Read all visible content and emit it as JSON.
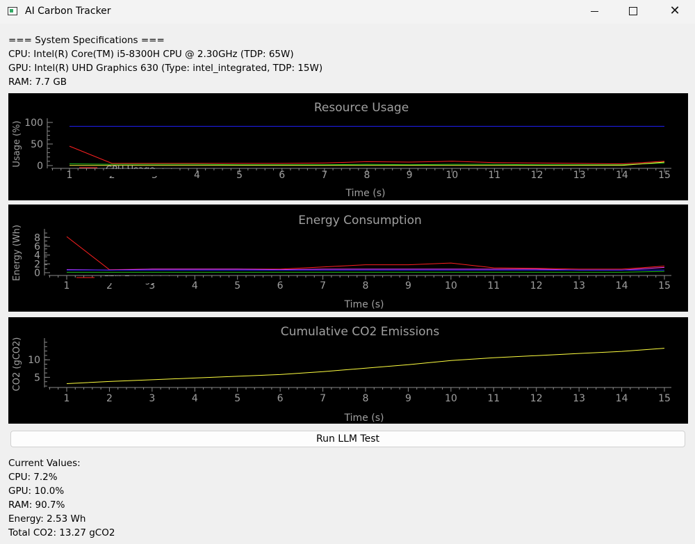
{
  "window": {
    "title": "AI Carbon Tracker"
  },
  "specs": {
    "header": "=== System Specifications ===",
    "cpu": "CPU: Intel(R) Core(TM) i5-8300H CPU @ 2.30GHz (TDP: 65W)",
    "gpu": "GPU: Intel(R) UHD Graphics 630 (Type: intel_integrated, TDP: 15W)",
    "ram": "RAM: 7.7 GB"
  },
  "chart_data": [
    {
      "type": "line",
      "title": "Resource Usage",
      "xlabel": "Time (s)",
      "ylabel": "Usage (%)",
      "x": [
        1,
        2,
        3,
        4,
        5,
        6,
        7,
        8,
        9,
        10,
        11,
        12,
        13,
        14,
        15
      ],
      "xlim": [
        1,
        15
      ],
      "ylim": [
        0,
        100
      ],
      "yticks": [
        0,
        50,
        100
      ],
      "series": [
        {
          "name": "CPU Usage",
          "color": "#ff2020",
          "values": [
            45,
            5,
            5,
            5,
            5,
            5,
            6,
            9,
            8,
            10,
            7,
            6,
            5,
            4,
            10
          ]
        },
        {
          "name": "",
          "color": "#20c020",
          "values": [
            4,
            3,
            3,
            3,
            2,
            2,
            2,
            3,
            2,
            3,
            3,
            2,
            2,
            2,
            6
          ]
        },
        {
          "name": "",
          "color": "#2020ff",
          "values": [
            91,
            91,
            91,
            91,
            91,
            91,
            91,
            91,
            91,
            91,
            91,
            91,
            91,
            91,
            91
          ]
        },
        {
          "name": "",
          "color": "#ffff40",
          "values": [
            0.5,
            0.5,
            0.5,
            0.5,
            0.5,
            0.5,
            0.5,
            0.5,
            0.5,
            0.5,
            0.5,
            0.5,
            0.5,
            0.5,
            8
          ]
        }
      ]
    },
    {
      "type": "line",
      "title": "Energy Consumption",
      "xlabel": "Time (s)",
      "ylabel": "Energy (Wh)",
      "x": [
        1,
        2,
        3,
        4,
        5,
        6,
        7,
        8,
        9,
        10,
        11,
        12,
        13,
        14,
        15
      ],
      "xlim": [
        1,
        15
      ],
      "ylim": [
        0,
        9
      ],
      "yticks": [
        0,
        2,
        4,
        6,
        8
      ],
      "series": [
        {
          "name": "CPU Energy",
          "color": "#ff2020",
          "values": [
            8.2,
            0.7,
            0.8,
            0.8,
            0.8,
            0.8,
            1.3,
            1.8,
            1.8,
            2.2,
            1.1,
            1.0,
            0.8,
            0.8,
            1.5
          ]
        },
        {
          "name": "",
          "color": "#ff40ff",
          "values": [
            0.7,
            0.6,
            0.8,
            0.8,
            0.8,
            0.7,
            0.8,
            0.8,
            0.8,
            0.8,
            0.8,
            0.8,
            0.6,
            0.6,
            1.2
          ]
        },
        {
          "name": "",
          "color": "#2020ff",
          "values": [
            0.6,
            0.6,
            0.6,
            0.6,
            0.6,
            0.6,
            0.6,
            0.6,
            0.6,
            0.6,
            0.6,
            0.6,
            0.6,
            0.6,
            0.6
          ]
        },
        {
          "name": "",
          "color": "#20c020",
          "values": [
            0.1,
            0.1,
            0.1,
            0.1,
            0.1,
            0.1,
            0.1,
            0.1,
            0.1,
            0.1,
            0.1,
            0.1,
            0.1,
            0.1,
            0.3
          ]
        }
      ]
    },
    {
      "type": "line",
      "title": "Cumulative CO2 Emissions",
      "xlabel": "Time (s)",
      "ylabel": "CO2 (gCO2)",
      "x": [
        1,
        2,
        3,
        4,
        5,
        6,
        7,
        8,
        9,
        10,
        11,
        12,
        13,
        14,
        15
      ],
      "xlim": [
        1,
        15
      ],
      "ylim": [
        2.5,
        15
      ],
      "yticks": [
        5,
        10
      ],
      "series": [
        {
          "name": "",
          "color": "#ffff40",
          "values": [
            3.2,
            3.8,
            4.3,
            4.8,
            5.3,
            5.8,
            6.6,
            7.6,
            8.6,
            9.8,
            10.6,
            11.2,
            11.8,
            12.4,
            13.3
          ]
        }
      ]
    }
  ],
  "actions": {
    "run_label": "Run LLM Test"
  },
  "current": {
    "header": "Current Values:",
    "cpu": "CPU: 7.2%",
    "gpu": "GPU: 10.0%",
    "ram": "RAM: 90.7%",
    "energy": "Energy: 2.53 Wh",
    "co2": "Total CO2: 13.27 gCO2"
  }
}
